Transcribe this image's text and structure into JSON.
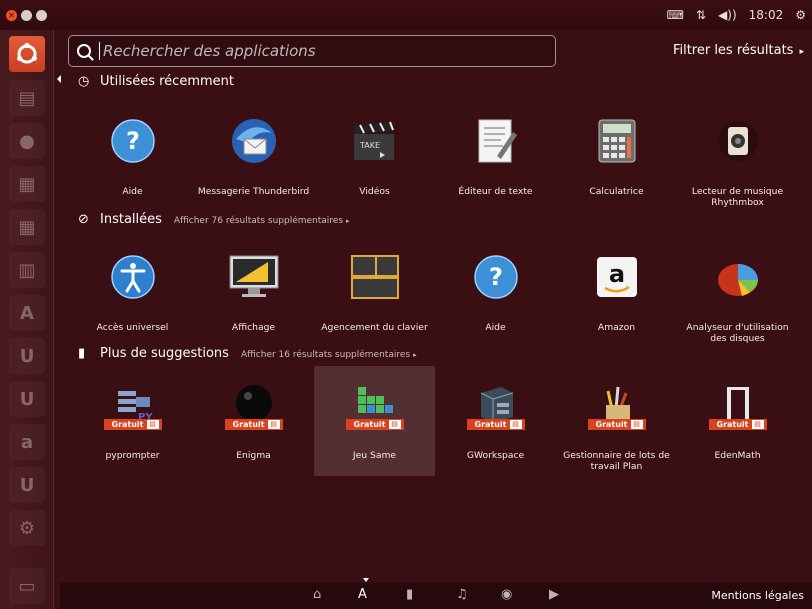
{
  "panel": {
    "time": "18:02",
    "volume_label": "◀))"
  },
  "search": {
    "placeholder": "Rechercher des applications",
    "filter_label": "Filtrer les résultats"
  },
  "sections": {
    "recent": {
      "title": "Utilisées récemment"
    },
    "installed": {
      "title": "Installées",
      "more": "Afficher 76 résultats supplémentaires"
    },
    "suggestions": {
      "title": "Plus de suggestions",
      "more": "Afficher 16 résultats supplémentaires"
    }
  },
  "recent_apps": [
    {
      "label": "Aide"
    },
    {
      "label": "Messagerie Thunderbird"
    },
    {
      "label": "Vidéos"
    },
    {
      "label": "Éditeur de texte"
    },
    {
      "label": "Calculatrice"
    },
    {
      "label": "Lecteur de musique Rhythmbox"
    }
  ],
  "installed_apps": [
    {
      "label": "Accès universel"
    },
    {
      "label": "Affichage"
    },
    {
      "label": "Agencement du clavier"
    },
    {
      "label": "Aide"
    },
    {
      "label": "Amazon"
    },
    {
      "label": "Analyseur d'utilisation des disques"
    }
  ],
  "suggested_apps": [
    {
      "label": "pyprompter",
      "badge": "Gratuit"
    },
    {
      "label": "Enigma",
      "badge": "Gratuit"
    },
    {
      "label": "Jeu Same",
      "badge": "Gratuit"
    },
    {
      "label": "GWorkspace",
      "badge": "Gratuit"
    },
    {
      "label": "Gestionnaire de lots de travail Plan",
      "badge": "Gratuit"
    },
    {
      "label": "EdenMath",
      "badge": "Gratuit"
    }
  ],
  "footer": {
    "legal": "Mentions légales"
  },
  "colors": {
    "background": "#3a0f14",
    "accent": "#d8431d"
  }
}
